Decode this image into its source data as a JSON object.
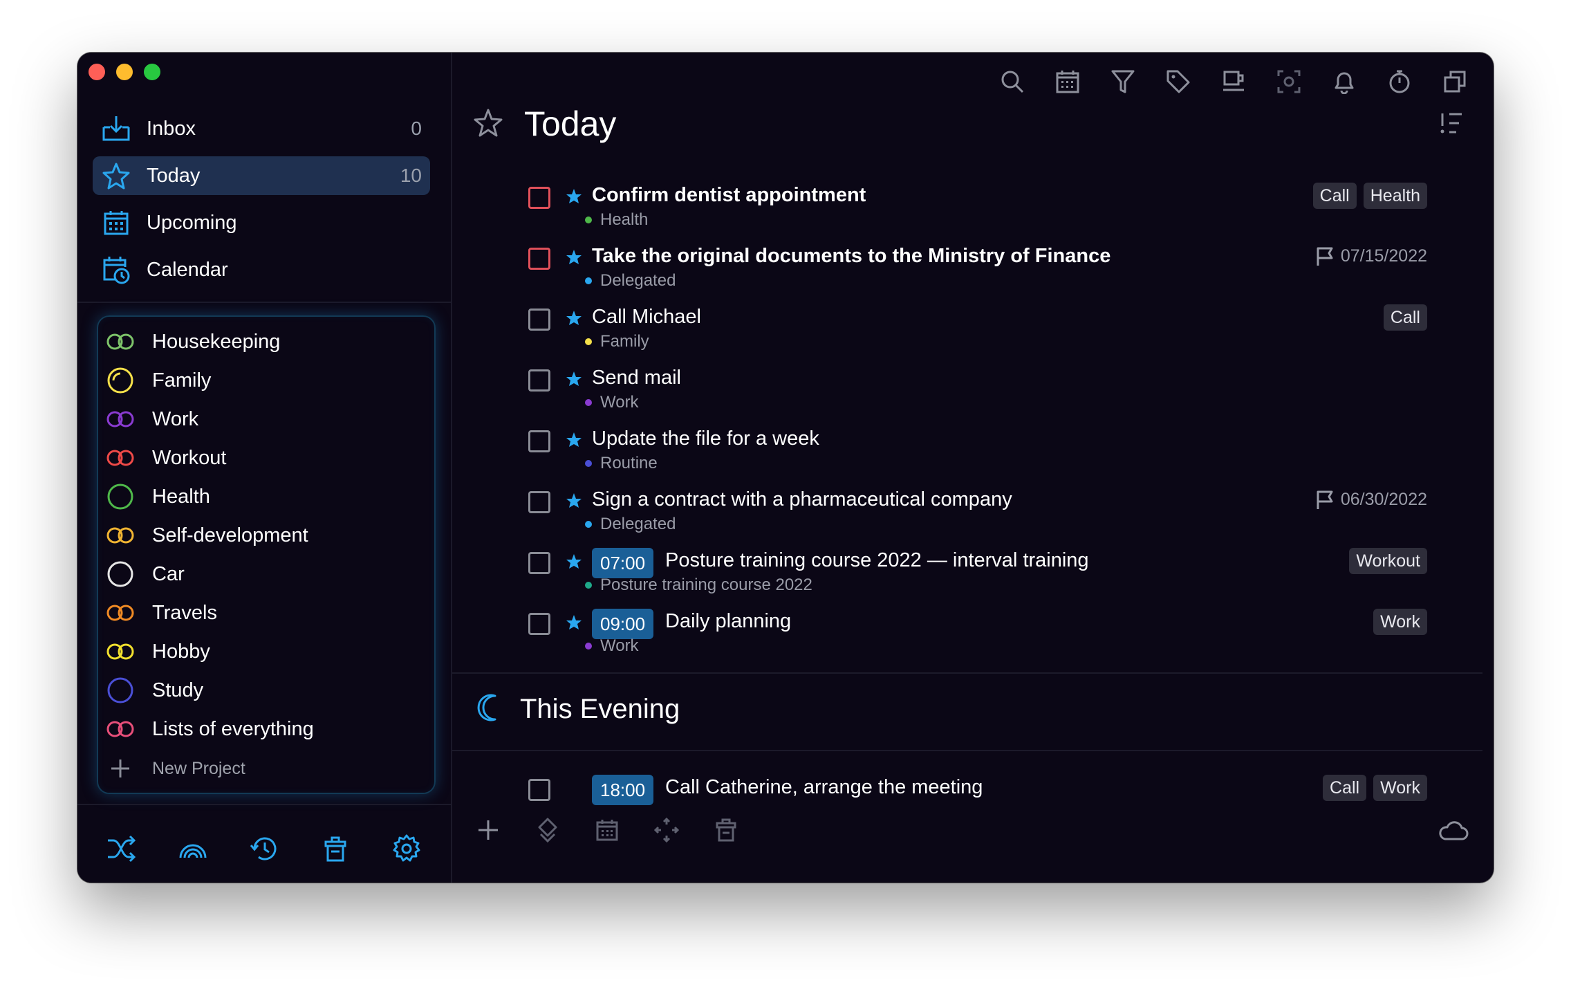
{
  "window": {
    "traffic_lights": [
      "close",
      "minimize",
      "zoom"
    ]
  },
  "sidebar": {
    "nav": [
      {
        "label": "Inbox",
        "count": "0",
        "icon": "inbox-icon"
      },
      {
        "label": "Today",
        "count": "10",
        "icon": "star-icon",
        "active": true
      },
      {
        "label": "Upcoming",
        "count": "",
        "icon": "upcoming-calendar-icon"
      },
      {
        "label": "Calendar",
        "count": "",
        "icon": "calendar-clock-icon"
      }
    ],
    "projects": [
      {
        "label": "Housekeeping",
        "color": "#7ec46a",
        "icon": "infinity-icon"
      },
      {
        "label": "Family",
        "color": "#f5e04a",
        "icon": "circle-progress-icon"
      },
      {
        "label": "Work",
        "color": "#8a3bd1",
        "icon": "infinity-icon"
      },
      {
        "label": "Workout",
        "color": "#ef4a48",
        "icon": "infinity-icon"
      },
      {
        "label": "Health",
        "color": "#4fb84a",
        "icon": "circle-icon"
      },
      {
        "label": "Self-development",
        "color": "#f2b532",
        "icon": "infinity-icon"
      },
      {
        "label": "Car",
        "color": "#e6e6e6",
        "icon": "circle-icon"
      },
      {
        "label": "Travels",
        "color": "#f08a24",
        "icon": "infinity-icon"
      },
      {
        "label": "Hobby",
        "color": "#f2e02e",
        "icon": "infinity-icon"
      },
      {
        "label": "Study",
        "color": "#4a4fd6",
        "icon": "circle-icon"
      },
      {
        "label": "Lists of everything",
        "color": "#e84f7a",
        "icon": "infinity-icon"
      }
    ],
    "new_project_label": "New Project",
    "bottom_icons": [
      "shuffle-icon",
      "rainbow-icon",
      "history-icon",
      "trash-icon",
      "settings-icon"
    ],
    "accent": "#2aa7ef"
  },
  "main": {
    "title": "Today",
    "toolbar_icons": [
      "search-icon",
      "calendar-grid-icon",
      "filter-icon",
      "tag-icon",
      "coffee-icon",
      "focus-icon",
      "bell-icon",
      "timer-icon",
      "copy-icon"
    ],
    "tasks": [
      {
        "title": "Confirm dentist appointment",
        "bold": true,
        "project": "Health",
        "dot": "#4fb84a",
        "check": "red",
        "time": "",
        "tags": [
          "Call",
          "Health"
        ],
        "due": ""
      },
      {
        "title": "Take the original documents to the Ministry of Finance",
        "bold": true,
        "project": "Delegated",
        "dot": "#2aa7ef",
        "check": "red",
        "time": "",
        "tags": [],
        "due": "07/15/2022"
      },
      {
        "title": "Call Michael",
        "bold": false,
        "project": "Family",
        "dot": "#f5e04a",
        "check": "gray",
        "time": "",
        "tags": [
          "Call"
        ],
        "due": ""
      },
      {
        "title": "Send mail",
        "bold": false,
        "project": "Work",
        "dot": "#8a3bd1",
        "check": "gray",
        "time": "",
        "tags": [],
        "due": ""
      },
      {
        "title": "Update the file for a week",
        "bold": false,
        "project": "Routine",
        "dot": "#4a4fd6",
        "check": "gray",
        "time": "",
        "tags": [],
        "due": ""
      },
      {
        "title": "Sign a contract with a pharmaceutical company",
        "bold": false,
        "project": "Delegated",
        "dot": "#2aa7ef",
        "check": "gray",
        "time": "",
        "tags": [],
        "due": "06/30/2022"
      },
      {
        "title": "Posture training course 2022 — interval training",
        "bold": false,
        "project": "Posture training course 2022",
        "dot": "#1fa98a",
        "check": "gray",
        "time": "07:00",
        "tags": [
          "Workout"
        ],
        "due": ""
      },
      {
        "title": "Daily planning",
        "bold": false,
        "project": "Work",
        "dot": "#8a3bd1",
        "check": "gray",
        "time": "09:00",
        "tags": [
          "Work"
        ],
        "due": ""
      }
    ],
    "evening": {
      "title": "This Evening",
      "tasks": [
        {
          "title": "Call Catherine, arrange the meeting",
          "time": "18:00",
          "tags": [
            "Call",
            "Work"
          ]
        }
      ]
    },
    "bottom_icons": [
      "add-icon",
      "move-icon",
      "calendar-grid-icon",
      "arrows-icon",
      "trash-icon",
      "cloud-icon"
    ]
  }
}
